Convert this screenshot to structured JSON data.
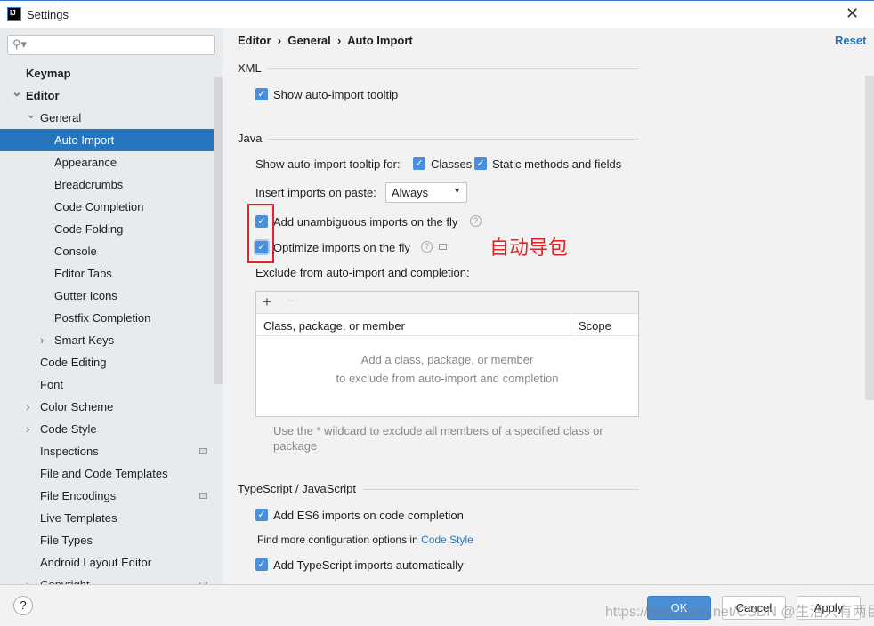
{
  "window": {
    "title": "Settings",
    "logo": "IJ"
  },
  "sidebar": {
    "search_placeholder": "",
    "items": [
      {
        "label": "Keymap"
      },
      {
        "label": "Editor"
      },
      {
        "label": "General"
      },
      {
        "label": "Auto Import"
      },
      {
        "label": "Appearance"
      },
      {
        "label": "Breadcrumbs"
      },
      {
        "label": "Code Completion"
      },
      {
        "label": "Code Folding"
      },
      {
        "label": "Console"
      },
      {
        "label": "Editor Tabs"
      },
      {
        "label": "Gutter Icons"
      },
      {
        "label": "Postfix Completion"
      },
      {
        "label": "Smart Keys"
      },
      {
        "label": "Code Editing"
      },
      {
        "label": "Font"
      },
      {
        "label": "Color Scheme"
      },
      {
        "label": "Code Style"
      },
      {
        "label": "Inspections"
      },
      {
        "label": "File and Code Templates"
      },
      {
        "label": "File Encodings"
      },
      {
        "label": "Live Templates"
      },
      {
        "label": "File Types"
      },
      {
        "label": "Android Layout Editor"
      },
      {
        "label": "Copyright"
      }
    ]
  },
  "breadcrumb": [
    "Editor",
    "General",
    "Auto Import"
  ],
  "reset": "Reset",
  "xml": {
    "title": "XML",
    "show_tooltip": "Show auto-import tooltip"
  },
  "java": {
    "title": "Java",
    "tooltip_for": "Show auto-import tooltip for:",
    "classes": "Classes",
    "static": "Static methods and fields",
    "paste_label": "Insert imports on paste:",
    "paste_value": "Always",
    "unambiguous": "Add unambiguous imports on the fly",
    "optimize": "Optimize imports on the fly",
    "exclude_label": "Exclude from auto-import and completion:",
    "col1": "Class, package, or member",
    "col2": "Scope",
    "empty1": "Add a class, package, or member",
    "empty2": "to exclude from auto-import and completion",
    "hint": "Use the * wildcard to exclude all members of a specified class or package"
  },
  "annotation": "自动导包",
  "ts": {
    "title": "TypeScript / JavaScript",
    "es6": "Add ES6 imports on code completion",
    "more": "Find more configuration options in ",
    "link": "Code Style",
    "tsauto": "Add TypeScript imports automatically"
  },
  "footer": {
    "ok": "OK",
    "cancel": "Cancel",
    "apply": "Apply",
    "watermark": "https://blog.csdn.net/CSDN @生活只有两目"
  },
  "colors": {
    "accent": "#2675bf",
    "annotation": "#e0242a"
  }
}
